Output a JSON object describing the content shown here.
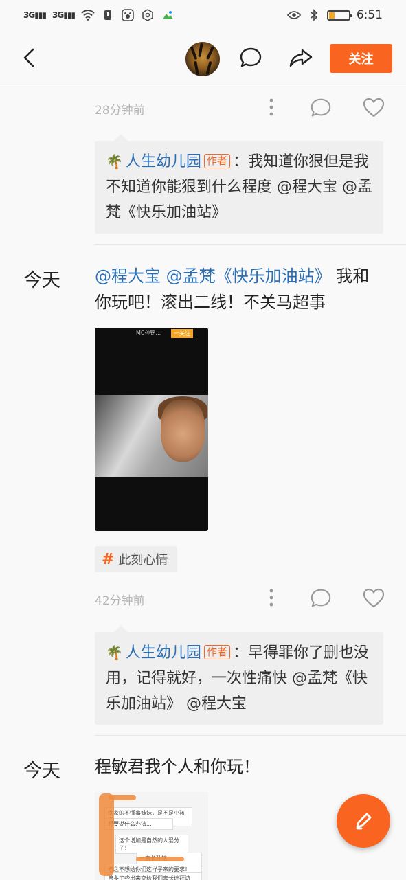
{
  "status_bar": {
    "signal1": "3G",
    "signal2": "3G",
    "time": "6:51",
    "battery_fraction": 0.2,
    "icons": [
      "signal-icon",
      "signal-icon",
      "wifi-icon",
      "sim-icon",
      "paw-app-icon",
      "hexagon-app-icon",
      "photos-app-icon",
      "eye-comfort-icon",
      "bluetooth-icon",
      "battery-icon"
    ]
  },
  "header": {
    "follow_label": "关注",
    "icons": [
      "back-icon",
      "avatar",
      "comment-icon",
      "share-icon"
    ]
  },
  "items": [
    {
      "time_ago": "28分钟前",
      "reply": {
        "user": "人生幼儿园",
        "tag": "作者",
        "text": "：我知道你狠但是我不知道你能狠到什么程度 @程大宝 @孟梵《快乐加油站》"
      }
    },
    {
      "date": "今天",
      "mention": "@程大宝 @孟梵《快乐加油站》",
      "text": " 我和你玩吧！滚出二线！不关马超事",
      "video": {
        "top_text": "MC孙铭...",
        "top_badge": "一关注"
      },
      "topic": "此刻心情",
      "time_ago": "42分钟前",
      "reply": {
        "user": "人生幼儿园",
        "tag": "作者",
        "text": "：早得罪你了删也没用，记得就好，一次性痛快 @孟梵《快乐加油站》 @程大宝"
      }
    },
    {
      "date": "今天",
      "text": "程敏君我个人和你玩！",
      "chat_lines": [
        "你家的不懂事妹妹，是不是小孩子",
        "想要说什么办法...",
        "这个增加是自然的人混分了！",
        "一直长孙铭",
        "老之不想给你们这样子来的要求！",
        "曾多了些出来交给我们去长途拜访"
      ]
    }
  ],
  "colors": {
    "accent": "#f96520",
    "link": "#2a6fb6",
    "meta": "#b5b5b5",
    "reply_bg": "#efefef"
  }
}
